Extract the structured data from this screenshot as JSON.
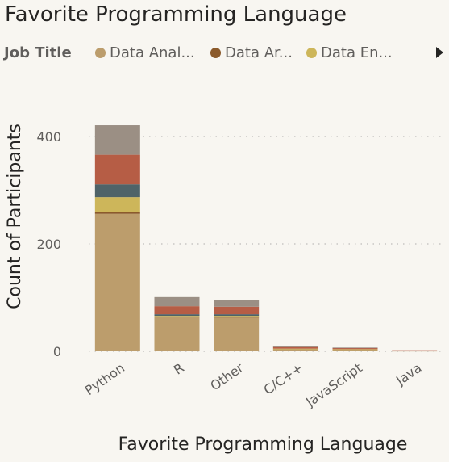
{
  "chart_data": {
    "type": "bar",
    "stacked": true,
    "title": "Favorite Programming Language",
    "xlabel": "Favorite Programming Language",
    "ylabel": "Count of Participants",
    "legend": {
      "title": "Job Title",
      "visible_entries": [
        "Data Anal...",
        "Data Ar...",
        "Data En..."
      ],
      "placement": "top"
    },
    "ylim": [
      0,
      450
    ],
    "yticks": [
      0,
      200,
      400
    ],
    "grid": true,
    "categories": [
      "Python",
      "R",
      "Other",
      "C/C++",
      "JavaScript",
      "Java"
    ],
    "series": [
      {
        "color": "#bc9d6c",
        "values": [
          256,
          64,
          63,
          4,
          3,
          1
        ]
      },
      {
        "color": "#8b5a2b",
        "values": [
          3,
          1,
          1,
          0,
          0,
          0
        ]
      },
      {
        "color": "#cdb65a",
        "values": [
          28,
          1,
          2,
          1,
          1,
          0
        ]
      },
      {
        "color": "#4f6368",
        "values": [
          24,
          3,
          3,
          0,
          0,
          0
        ]
      },
      {
        "color": "#b65d45",
        "values": [
          55,
          15,
          14,
          3,
          2,
          1
        ]
      },
      {
        "color": "#9b8f84",
        "values": [
          55,
          17,
          13,
          1,
          1,
          0
        ]
      }
    ]
  },
  "legend_colors": [
    "#bc9d6c",
    "#8b5a2b",
    "#cdb65a"
  ]
}
